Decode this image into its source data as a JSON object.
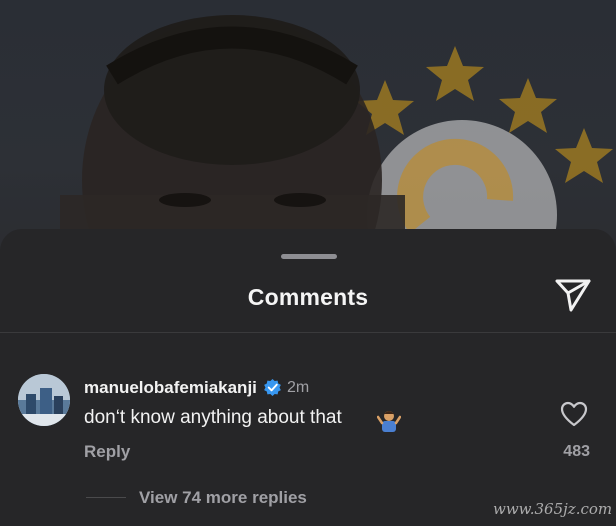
{
  "sheet": {
    "title": "Comments",
    "send_icon": "paper-plane-icon"
  },
  "comment": {
    "username": "manuelobafemiakanji",
    "verified_icon": "verified-badge-icon",
    "time": "2m",
    "text": "don‘t know anything about that",
    "emoji_icon": "person-shrugging-emoji",
    "reply_label": "Reply",
    "like_icon": "heart-icon",
    "likes": "483",
    "view_replies": "View 74 more replies"
  },
  "watermark": "www.365jz.com",
  "colors": {
    "sheet_bg": "#262628",
    "primary_text": "#f2f2f2",
    "secondary_text": "#a0a0a5",
    "verified_blue": "#3897f0",
    "star_gold": "#e6a817"
  }
}
